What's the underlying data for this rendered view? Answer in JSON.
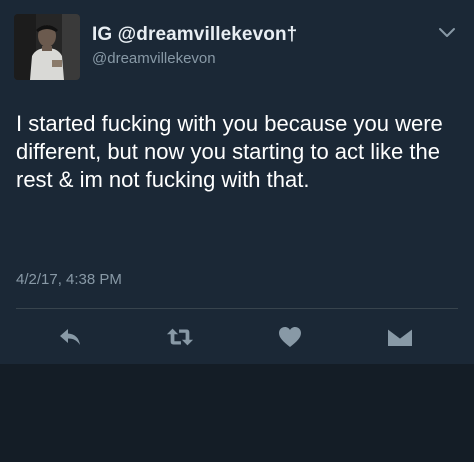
{
  "tweet": {
    "display_name": "IG @dreamvillekevon†",
    "handle": "@dreamvillekevon",
    "text": "I started fucking with you because you were different, but now you starting to act like the rest & im not fucking with that.",
    "timestamp": "4/2/17, 4:38 PM"
  },
  "icons": {
    "more": "chevron-down-icon",
    "reply": "reply-icon",
    "retweet": "retweet-icon",
    "like": "heart-icon",
    "dm": "envelope-icon"
  },
  "colors": {
    "card_background": "#1b2836",
    "page_background": "#141d26",
    "primary_text": "#ffffff",
    "secondary_text": "#8899a6",
    "icon_color": "#8899a6"
  }
}
